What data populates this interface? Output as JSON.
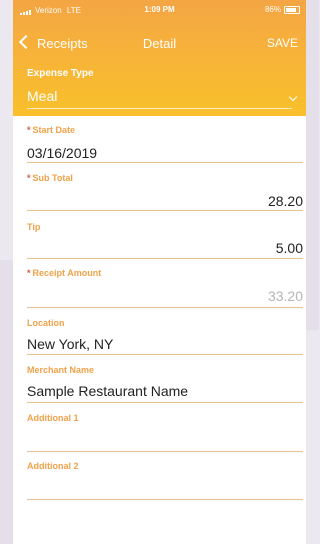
{
  "status": {
    "carrier": "Verizon",
    "network": "LTE",
    "time": "1:09 PM",
    "battery": "86%"
  },
  "nav": {
    "back": "Receipts",
    "title": "Detail",
    "save": "SAVE"
  },
  "expense_type": {
    "label": "Expense Type",
    "value": "Meal"
  },
  "fields": {
    "start_date": {
      "label": "Start Date",
      "value": "03/16/2019",
      "required": "*"
    },
    "sub_total": {
      "label": "Sub Total",
      "value": "28.20",
      "required": "*"
    },
    "tip": {
      "label": "Tip",
      "value": "5.00"
    },
    "receipt_amount": {
      "label": "Receipt Amount",
      "value": "33.20",
      "required": "*"
    },
    "location": {
      "label": "Location",
      "value": "New York, NY"
    },
    "merchant_name": {
      "label": "Merchant Name",
      "value": "Sample Restaurant Name"
    },
    "additional_1": {
      "label": "Additional 1",
      "value": ""
    },
    "additional_2": {
      "label": "Additional 2",
      "value": ""
    }
  }
}
